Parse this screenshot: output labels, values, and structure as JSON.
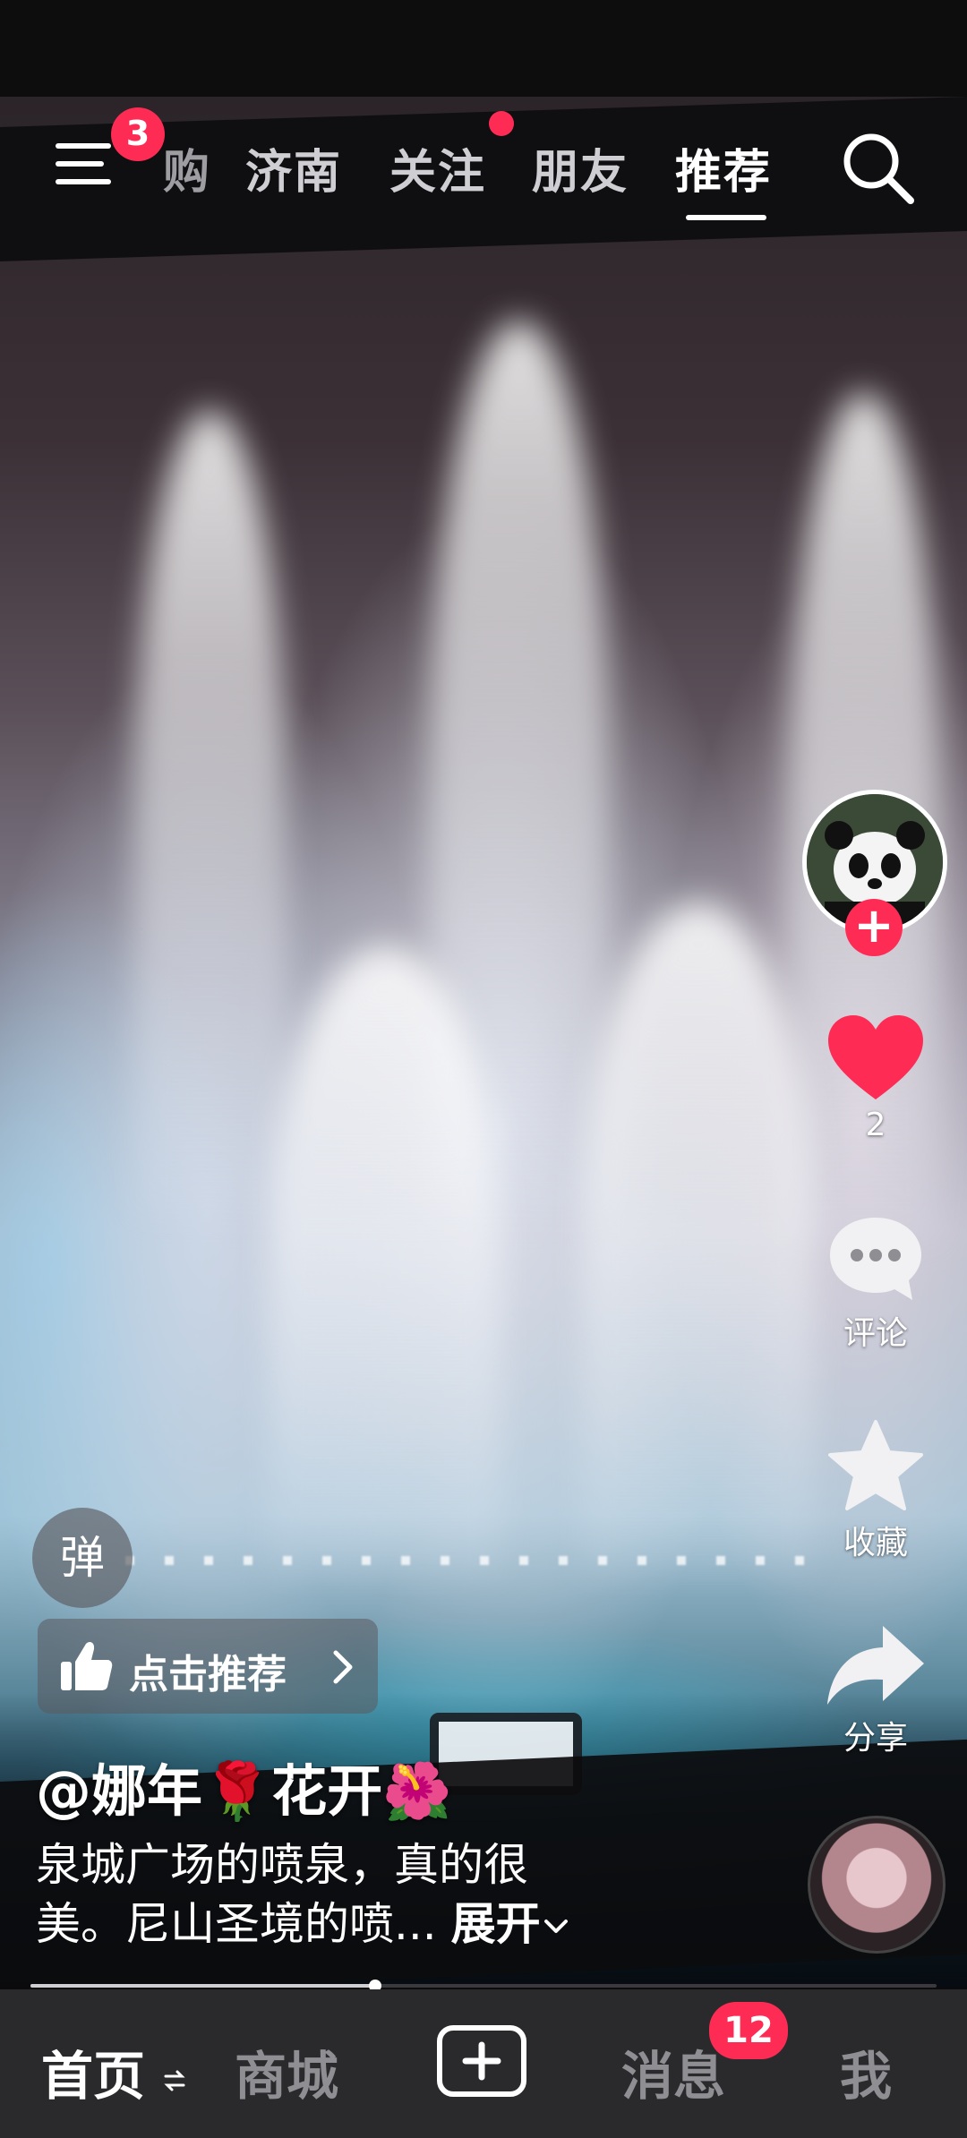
{
  "top_nav": {
    "menu_badge": "3",
    "tabs": [
      "购",
      "济南",
      "关注",
      "朋友",
      "推荐"
    ],
    "active_tab": "推荐"
  },
  "right_rail": {
    "like_count": "2",
    "comment_label": "评论",
    "favorite_label": "收藏",
    "share_label": "分享"
  },
  "overlay": {
    "danmu_label": "弹",
    "recommend_label": "点击推荐",
    "author": "@娜年🌹花开🌺",
    "description_line1": "泉城广场的喷泉，真的很",
    "description_line2": "美。尼山圣境的喷...",
    "expand_label": "展开",
    "progress": 0.38
  },
  "bottom_tabs": {
    "home": "首页",
    "mall": "商城",
    "messages": "消息",
    "messages_badge": "12",
    "me": "我"
  },
  "colors": {
    "accent": "#fe2c55",
    "bar_bg": "#2a2a2c"
  }
}
